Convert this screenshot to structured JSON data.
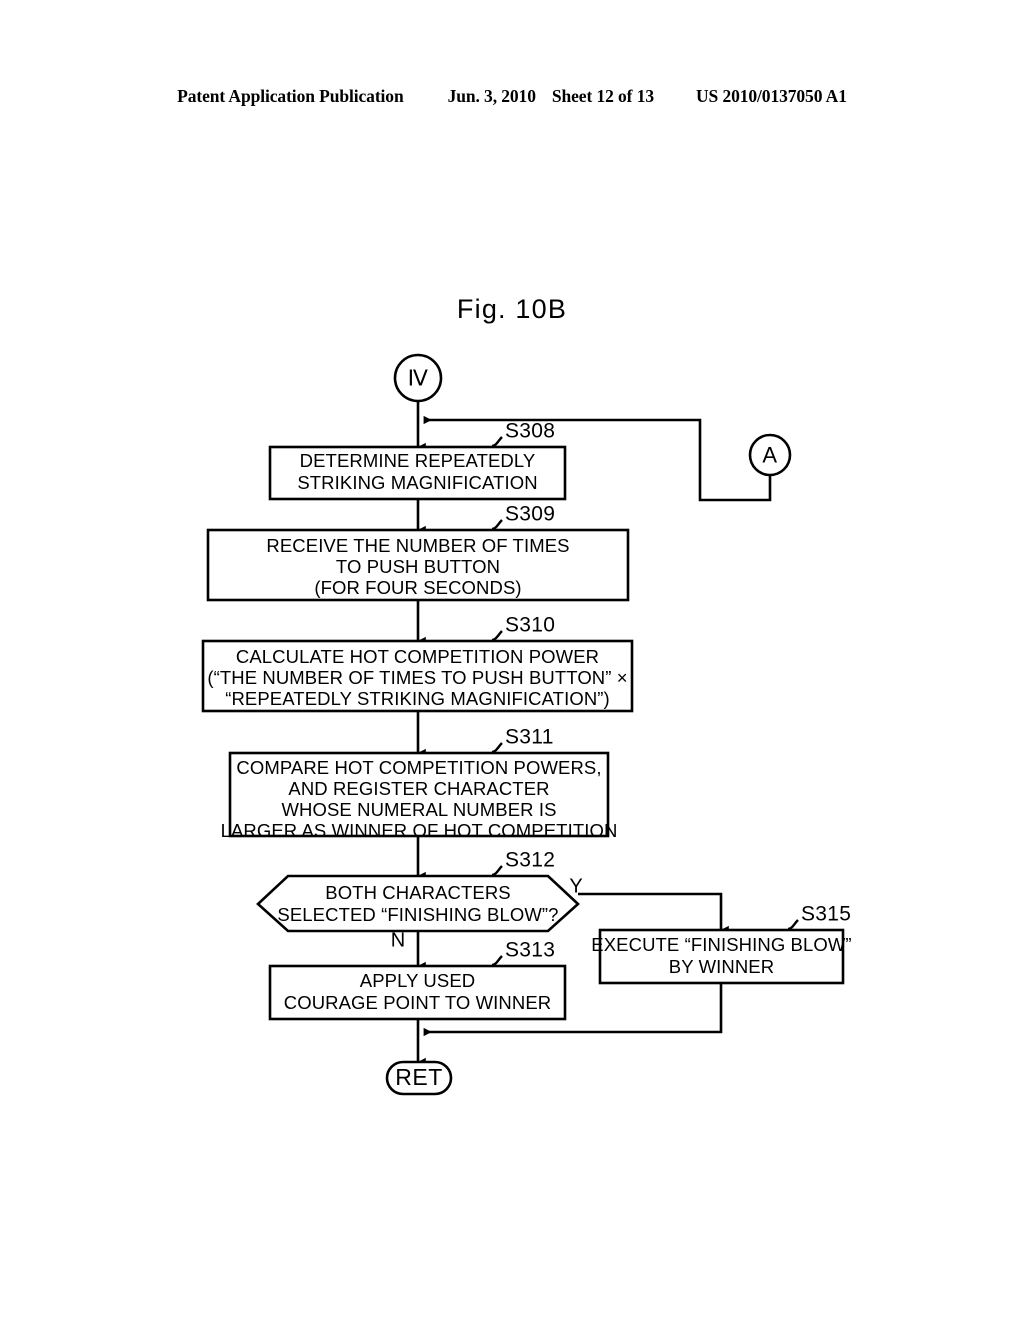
{
  "header": {
    "publication": "Patent Application Publication",
    "date": "Jun. 3, 2010",
    "sheet": "Sheet 12 of 13",
    "number": "US 2010/0137050 A1"
  },
  "figure": {
    "title": "Fig. 10B"
  },
  "flowchart": {
    "entry_connector": {
      "id": "entry-connector",
      "label": "Ⅳ"
    },
    "return_connector": {
      "id": "return-connector",
      "label": "A"
    },
    "terminator": {
      "id": "terminator-ret",
      "label": "RET"
    },
    "branches": {
      "yes": "Y",
      "no": "N"
    },
    "steps": [
      {
        "id": "s308",
        "ref": "S308",
        "type": "process",
        "lines": [
          "DETERMINE REPEATEDLY",
          "STRIKING MAGNIFICATION"
        ]
      },
      {
        "id": "s309",
        "ref": "S309",
        "type": "process",
        "lines": [
          "RECEIVE THE NUMBER OF TIMES",
          "TO PUSH BUTTON",
          "(FOR FOUR SECONDS)"
        ]
      },
      {
        "id": "s310",
        "ref": "S310",
        "type": "process",
        "lines": [
          "CALCULATE HOT COMPETITION POWER",
          "(“THE NUMBER OF TIMES TO PUSH BUTTON” ×",
          "“REPEATEDLY STRIKING MAGNIFICATION”)"
        ]
      },
      {
        "id": "s311",
        "ref": "S311",
        "type": "process",
        "lines": [
          "COMPARE HOT COMPETITION POWERS,",
          "AND REGISTER CHARACTER",
          "WHOSE NUMERAL NUMBER IS",
          "LARGER AS WINNER OF HOT COMPETITION"
        ]
      },
      {
        "id": "s312",
        "ref": "S312",
        "type": "decision",
        "lines": [
          "BOTH CHARACTERS",
          "SELECTED “FINISHING BLOW”?"
        ]
      },
      {
        "id": "s313",
        "ref": "S313",
        "type": "process",
        "lines": [
          "APPLY USED",
          "COURAGE POINT TO WINNER"
        ]
      },
      {
        "id": "s315",
        "ref": "S315",
        "type": "process",
        "lines": [
          "EXECUTE “FINISHING BLOW”",
          "BY WINNER"
        ]
      }
    ]
  }
}
